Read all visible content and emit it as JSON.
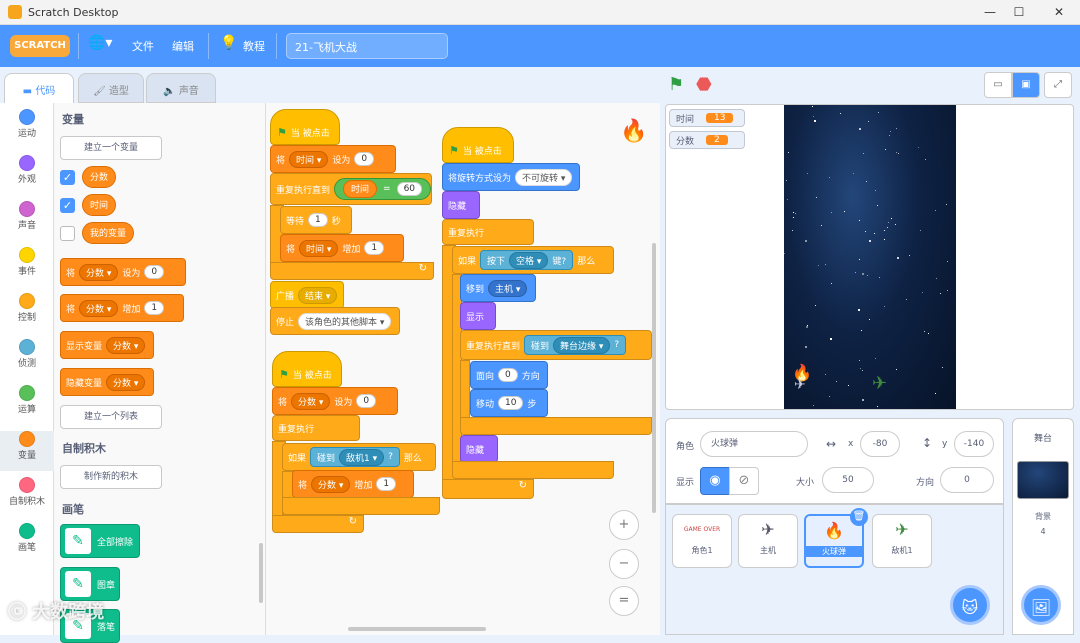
{
  "window": {
    "title": "Scratch Desktop",
    "min": "—",
    "max": "☐",
    "close": "✕"
  },
  "menu": {
    "logo": "SCRATCH",
    "globe": "🌐▾",
    "file": "文件",
    "edit": "编辑",
    "tutorials": "教程",
    "project_title": "21-飞机大战"
  },
  "tabs": {
    "code": "代码",
    "costumes": "造型",
    "sounds": "声音"
  },
  "categories": [
    {
      "label": "运动",
      "color": "#4c97ff"
    },
    {
      "label": "外观",
      "color": "#9966ff"
    },
    {
      "label": "声音",
      "color": "#cf63cf"
    },
    {
      "label": "事件",
      "color": "#ffd500"
    },
    {
      "label": "控制",
      "color": "#ffab19"
    },
    {
      "label": "侦测",
      "color": "#5cb1d6"
    },
    {
      "label": "运算",
      "color": "#59c059"
    },
    {
      "label": "变量",
      "color": "#ff8c1a"
    },
    {
      "label": "自制积木",
      "color": "#ff6680"
    },
    {
      "label": "画笔",
      "color": "#0fbd8c"
    }
  ],
  "palette": {
    "variables_heading": "变量",
    "make_variable": "建立一个变量",
    "vars": [
      {
        "name": "分数",
        "checked": true
      },
      {
        "name": "时间",
        "checked": true
      },
      {
        "name": "我的变量",
        "checked": false
      }
    ],
    "set_block": {
      "a": "将",
      "var": "分数 ▾",
      "b": "设为",
      "val": "0"
    },
    "change_block": {
      "a": "将",
      "var": "分数 ▾",
      "b": "增加",
      "val": "1"
    },
    "show_block": {
      "a": "显示变量",
      "var": "分数 ▾"
    },
    "hide_block": {
      "a": "隐藏变量",
      "var": "分数 ▾"
    },
    "make_list": "建立一个列表",
    "myblocks_heading": "自制积木",
    "make_block": "制作新的积木",
    "pen_heading": "画笔",
    "pen_clear": "全部擦除",
    "pen_stamp": "图章",
    "pen_down": "落笔"
  },
  "scripts": {
    "s1": {
      "hat": "当 被点击",
      "set": {
        "a": "将",
        "var": "时间 ▾",
        "b": "设为",
        "val": "0"
      },
      "repeat_until": "重复执行直到",
      "cond": {
        "var": "时间",
        "op": "=",
        "val": "60"
      },
      "wait": {
        "a": "等待",
        "val": "1",
        "b": "秒"
      },
      "change": {
        "a": "将",
        "var": "时间 ▾",
        "b": "增加",
        "val": "1"
      },
      "broadcast": {
        "a": "广播",
        "msg": "结束 ▾"
      },
      "stop": {
        "a": "停止",
        "opt": "该角色的其他脚本 ▾"
      }
    },
    "s2": {
      "hat": "当 被点击",
      "set": {
        "a": "将",
        "var": "分数 ▾",
        "b": "设为",
        "val": "0"
      },
      "forever": "重复执行",
      "if": {
        "a": "如果",
        "sense": "碰到",
        "target": "敌机1 ▾",
        "q": "?",
        "then": "那么"
      },
      "change": {
        "a": "将",
        "var": "分数 ▾",
        "b": "增加",
        "val": "1"
      }
    },
    "s3": {
      "hat": "当 被点击",
      "rotation": {
        "a": "将旋转方式设为",
        "opt": "不可旋转 ▾"
      },
      "hide": "隐藏",
      "forever": "重复执行",
      "if": {
        "a": "如果",
        "b": "按下",
        "key": "空格 ▾",
        "c": "键?",
        "then": "那么"
      },
      "goto": {
        "a": "移到",
        "target": "主机 ▾"
      },
      "show": "显示",
      "repeat_until": "重复执行直到",
      "touch": {
        "a": "碰到",
        "target": "舞台边缘 ▾",
        "q": "?"
      },
      "point": {
        "a": "面向",
        "val": "0",
        "b": "方向"
      },
      "move": {
        "a": "移动",
        "val": "10",
        "b": "步"
      },
      "hide2": "隐藏"
    }
  },
  "zoom": {
    "in": "+",
    "out": "−",
    "reset": "="
  },
  "stage_controls": {
    "flag": "⚑",
    "stop": "⬣"
  },
  "monitors": [
    {
      "label": "时间",
      "value": "13"
    },
    {
      "label": "分数",
      "value": "2"
    }
  ],
  "sprite_info": {
    "sprite_label": "角色",
    "sprite_name": "火球弹",
    "x_label": "x",
    "x": "-80",
    "y_label": "y",
    "y": "-140",
    "show_label": "显示",
    "size_label": "大小",
    "size": "50",
    "dir_label": "方向",
    "direction": "0"
  },
  "sprites": [
    {
      "name": "角色1",
      "icon": "GAME OVER",
      "selected": false
    },
    {
      "name": "主机",
      "icon": "✈",
      "selected": false
    },
    {
      "name": "火球弹",
      "icon": "🔥",
      "selected": true
    },
    {
      "name": "敌机1",
      "icon": "✈",
      "selected": false
    }
  ],
  "stage_panel": {
    "title": "舞台",
    "backdrops_label": "背景",
    "backdrops_count": "4"
  },
  "watermark": "大数跨境"
}
